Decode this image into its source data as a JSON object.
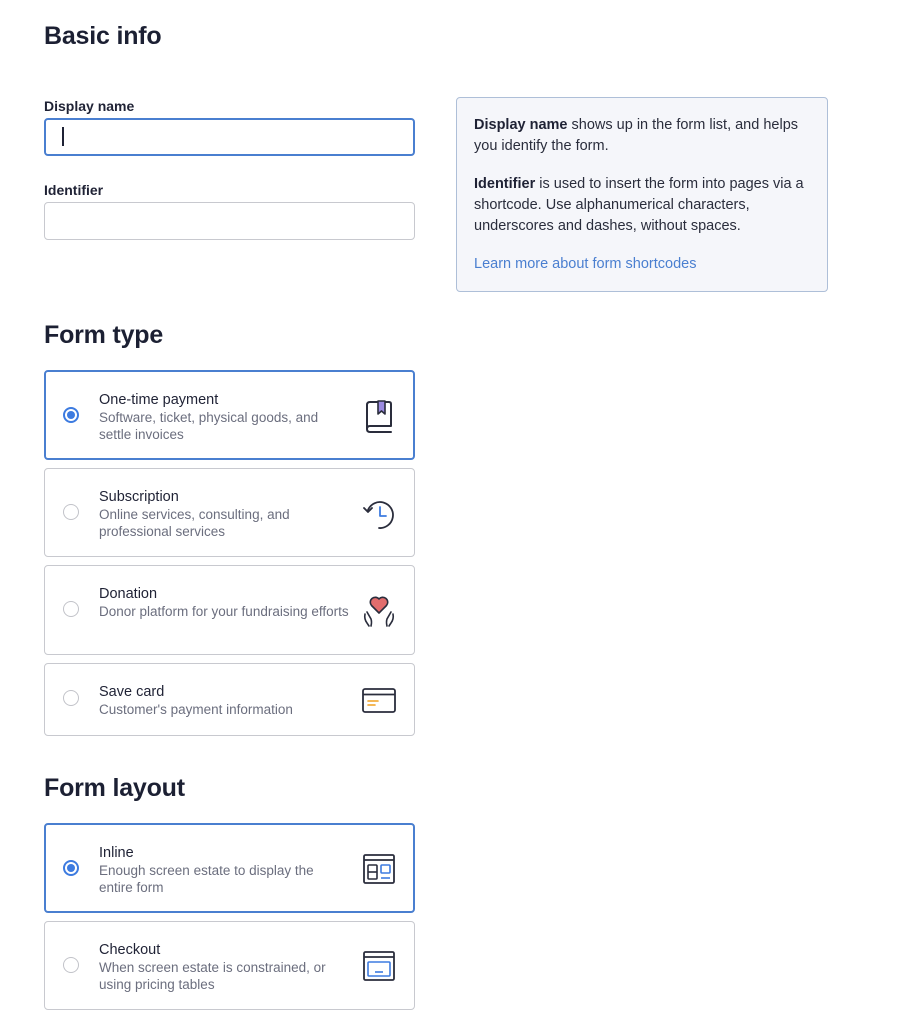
{
  "basic_info": {
    "title": "Basic info",
    "display_name": {
      "label": "Display name",
      "value": "",
      "placeholder": ""
    },
    "identifier": {
      "label": "Identifier",
      "value": "",
      "placeholder": ""
    }
  },
  "help": {
    "display_name_bold": "Display name",
    "display_name_text": " shows up in the form list, and helps you identify the form.",
    "identifier_bold": "Identifier",
    "identifier_text": " is used to insert the form into pages via a shortcode. Use alphanumerical characters, underscores and dashes, without spaces.",
    "link_label": "Learn more about form shortcodes"
  },
  "form_type": {
    "title": "Form type",
    "selected": "one-time-payment",
    "options": [
      {
        "id": "one-time-payment",
        "title": "One-time payment",
        "description": "Software, ticket, physical goods, and settle invoices",
        "icon": "book-icon",
        "selected": true
      },
      {
        "id": "subscription",
        "title": "Subscription",
        "description": "Online services, consulting, and professional services",
        "icon": "clock-history-icon",
        "selected": false
      },
      {
        "id": "donation",
        "title": "Donation",
        "description": "Donor platform for your fundraising efforts",
        "icon": "heart-hands-icon",
        "selected": false
      },
      {
        "id": "save-card",
        "title": "Save card",
        "description": "Customer's payment information",
        "icon": "credit-card-icon",
        "selected": false
      }
    ]
  },
  "form_layout": {
    "title": "Form layout",
    "selected": "inline",
    "options": [
      {
        "id": "inline",
        "title": "Inline",
        "description": "Enough screen estate to display the entire form",
        "icon": "inline-layout-icon",
        "selected": true
      },
      {
        "id": "checkout",
        "title": "Checkout",
        "description": "When screen estate is constrained, or using pricing tables",
        "icon": "checkout-layout-icon",
        "selected": false
      }
    ]
  },
  "colors": {
    "accent": "#4a7fd0",
    "radio_selected": "#3d7be0",
    "heading": "#1c2033",
    "muted_text": "#6b6e7e",
    "help_bg": "#f5f6fa",
    "bookmark_purple": "#9b8ae0",
    "heart_red": "#e26d6d",
    "card_stripe_orange": "#f0a020"
  }
}
